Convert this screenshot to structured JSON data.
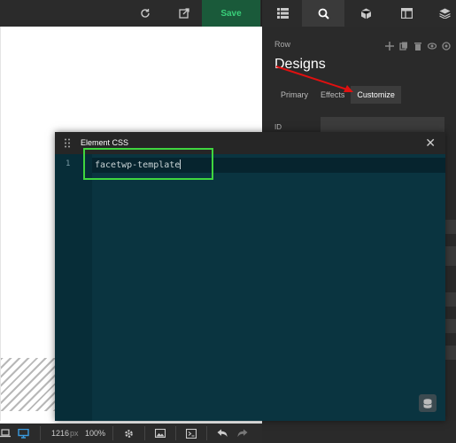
{
  "toolbar": {
    "save_label": "Save",
    "icons": [
      "refresh-icon",
      "external-link-icon",
      "list-icon",
      "search-icon",
      "cube-icon",
      "layout-icon",
      "layers-icon"
    ]
  },
  "panel": {
    "label": "Row",
    "title": "Designs",
    "tabs": [
      {
        "label": "Primary",
        "active": false
      },
      {
        "label": "Effects",
        "active": false
      },
      {
        "label": "Customize",
        "active": true
      }
    ],
    "id_label": "ID"
  },
  "modal": {
    "title": "Element CSS",
    "line_number": "1",
    "code": "facetwp-template"
  },
  "bottombar": {
    "width_value": "1216",
    "width_unit": "px",
    "zoom": "100%"
  },
  "colors": {
    "save_bg": "#1a5a3a",
    "save_text": "#3ad07a",
    "editor_bg": "#0a3440",
    "highlight": "#3fd63f",
    "arrow": "#e01010"
  }
}
